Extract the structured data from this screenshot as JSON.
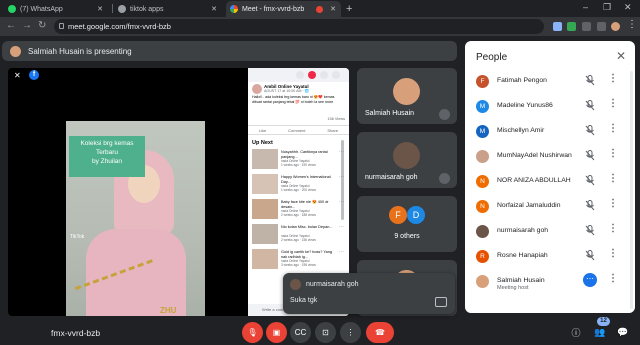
{
  "browser": {
    "tabs": [
      {
        "title": "(7) WhatsApp",
        "favicon_color": "#25d366"
      },
      {
        "title": "tiktok apps",
        "favicon_color": "#9aa0a6"
      },
      {
        "title": "Meet - fmx-vvrd-bzb",
        "favicon_color": "#00ac47"
      }
    ],
    "new_tab_label": "+",
    "url": "meet.google.com/fmx-vvrd-bzb"
  },
  "meet": {
    "presenting_text": "Salmiah Husain is presenting",
    "stage": {
      "banner_lines": [
        "Koleksi brg kemas",
        "Terbaru",
        "by Zhuilan"
      ],
      "watermark": "ZHU",
      "tiktok_label": "TikTok",
      "facebook_post": {
        "author": "Ambil Online Yayatul",
        "meta": "AGUST 17 at 10:00 AM · 🌐",
        "body": "Hallo!!.. ada koleksi brg kemas baru ni 😍❤️ kemas dibuat rantai panjang tebal 💯 ni boleh la see more",
        "stats": "156 Views",
        "actions": [
          "Like",
          "Comment",
          "Share"
        ],
        "up_next_label": "Up Next",
        "recommendations": [
          {
            "title": "Nusyahhh. Cantiknya rantai panjang...",
            "source": "nada Online Yayatul",
            "age": "1 weeks ago · 190 views"
          },
          {
            "title": "Happy Women's International Day...",
            "source": "nada Online Yayatul",
            "age": "1 weeks ago · 200 views"
          },
          {
            "title": "Baby face kite nie 😍 400 dr desain...",
            "source": "nada Online Yayatul",
            "age": "2 weeks ago · 188 views"
          },
          {
            "title": "Nio kolan Misc. bulan Depan...",
            "source": "nada Online Yayatul",
            "age": "2 weeks ago · 156 views"
          },
          {
            "title": "Gold ig cantik ke? boss? Yang nak radhiah ig...",
            "source": "nada Online Yayatul",
            "age": "3 weeks ago · 198 views"
          }
        ],
        "comment_placeholder": "Write a comment..."
      }
    },
    "tiles": [
      {
        "name": "Salmiah Husain"
      },
      {
        "name": "nurmaisarah goh"
      },
      {
        "others_label": "9 others",
        "initials": [
          "F",
          "D"
        ]
      }
    ],
    "chat_toast": {
      "sender": "nurmaisarah goh",
      "message": "Suka tgk"
    },
    "meeting_code": "fmx-vvrd-bzb",
    "participant_count": "12"
  },
  "people_panel": {
    "title": "People",
    "participants": [
      {
        "name": "Fatimah Pengon",
        "initial": "F",
        "color": "#c5522b"
      },
      {
        "name": "Madeline Yunus86",
        "initial": "M",
        "color": "#1e88e5"
      },
      {
        "name": "Mischellyn Amir",
        "initial": "M",
        "color": "#1565c0"
      },
      {
        "name": "MumNayAdel Nushirwan",
        "initial": "",
        "color": "#c9a18b"
      },
      {
        "name": "NOR ANIZA ABDULLAH",
        "initial": "N",
        "color": "#ef6c00"
      },
      {
        "name": "Norfaizal Jamaluddin",
        "initial": "N",
        "color": "#ef6c00"
      },
      {
        "name": "nurmaisarah goh",
        "initial": "",
        "color": "#6b5548"
      },
      {
        "name": "Rosne Hanapiah",
        "initial": "R",
        "color": "#e65100"
      },
      {
        "name": "Salmiah Husain",
        "initial": "",
        "color": "#d8a07a",
        "subtitle": "Meeting host"
      }
    ]
  }
}
